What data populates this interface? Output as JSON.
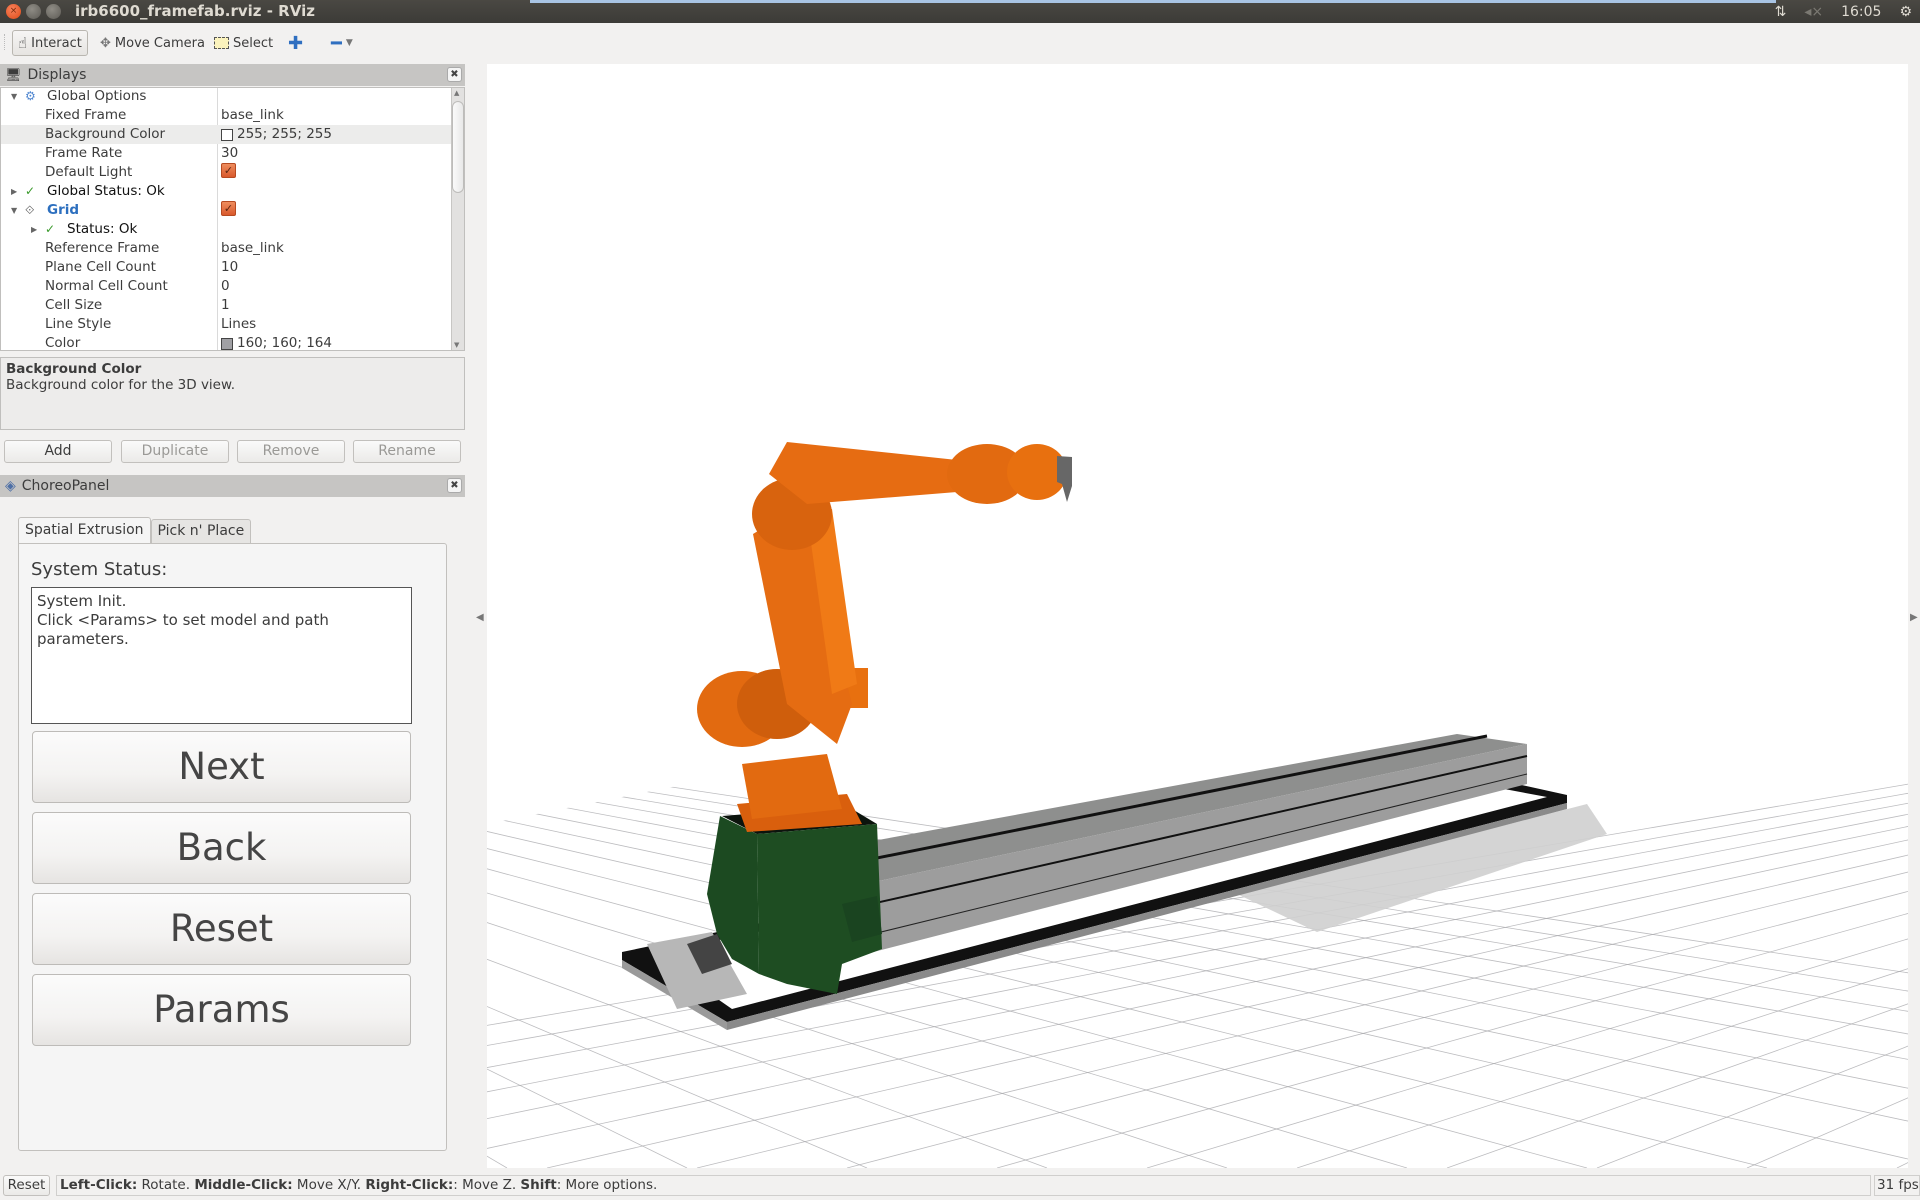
{
  "window": {
    "title": "irb6600_framefab.rviz - RViz",
    "buttons": {
      "close": "×",
      "minimize": "–",
      "maximize": "□"
    }
  },
  "tray": {
    "network_icon": "⇅",
    "volume_icon": "🔇",
    "volume_glyph": "◂×",
    "clock": "16:05",
    "power_icon": "⚙"
  },
  "toolbar": {
    "tools": [
      {
        "label": "Interact",
        "icon": "hand-pointer-icon",
        "glyph": "☝",
        "active": true
      },
      {
        "label": "Move Camera",
        "icon": "move-camera-icon",
        "glyph": "✥",
        "active": false
      },
      {
        "label": "Select",
        "icon": "select-box-icon",
        "glyph": "",
        "active": false
      }
    ],
    "add_tool_glyph": "✚",
    "remove_tool_glyph": "━",
    "dropdown_glyph": "▼"
  },
  "displays_panel": {
    "title": "Displays",
    "icon_glyph": "🖥",
    "close_glyph": "✖",
    "rows": [
      {
        "indent": 0,
        "expander": "▼",
        "icon": "gear-icon",
        "icon_glyph": "⚙",
        "label": "Global Options",
        "value": ""
      },
      {
        "indent": 1,
        "label": "Fixed Frame",
        "value": "base_link"
      },
      {
        "indent": 1,
        "label": "Background Color",
        "value": "255; 255; 255",
        "swatch": "#ffffff",
        "selected": true
      },
      {
        "indent": 1,
        "label": "Frame Rate",
        "value": "30"
      },
      {
        "indent": 1,
        "label": "Default Light",
        "checkbox": true,
        "checked": true
      },
      {
        "indent": 0,
        "expander": "▶",
        "icon": "check-icon",
        "icon_glyph": "✓",
        "label": "Global Status: Ok",
        "value": ""
      },
      {
        "indent": 0,
        "expander": "▼",
        "icon": "grid-icon",
        "icon_glyph": "⟐",
        "label": "Grid",
        "value": "",
        "checkbox": true,
        "checked": true,
        "highlight": true
      },
      {
        "indent": 1,
        "expander": "▶",
        "icon": "check-icon",
        "icon_glyph": "✓",
        "label": "Status: Ok",
        "value": ""
      },
      {
        "indent": 1,
        "label": "Reference Frame",
        "value": "base_link"
      },
      {
        "indent": 1,
        "label": "Plane Cell Count",
        "value": "10"
      },
      {
        "indent": 1,
        "label": "Normal Cell Count",
        "value": "0"
      },
      {
        "indent": 1,
        "label": "Cell Size",
        "value": "1"
      },
      {
        "indent": 1,
        "label": "Line Style",
        "value": "Lines"
      },
      {
        "indent": 1,
        "label": "Color",
        "value": "160; 160; 164",
        "swatch": "#a0a0a4"
      }
    ],
    "description": {
      "title": "Background Color",
      "text": "Background color for the 3D view."
    },
    "buttons": {
      "add": "Add",
      "duplicate": "Duplicate",
      "remove": "Remove",
      "rename": "Rename"
    }
  },
  "choreo_panel": {
    "title": "ChoreoPanel",
    "icon_glyph": "◈",
    "close_glyph": "✖",
    "tabs": [
      {
        "label": "Spatial Extrusion",
        "active": true
      },
      {
        "label": "Pick n' Place",
        "active": false
      }
    ],
    "system_status_label": "System Status:",
    "system_status_text": "System Init.\nClick <Params> to set model and path\nparameters.",
    "buttons": {
      "next": "Next",
      "back": "Back",
      "reset": "Reset",
      "params": "Params"
    }
  },
  "viewport": {
    "background_color": "#ffffff",
    "grid_color": "#a0a0a4",
    "robot_color": "#e8680f",
    "base_color": "#1e4d22",
    "rail_color": "#8f908f",
    "left_collapse_glyph": "◀",
    "right_collapse_glyph": "▶"
  },
  "statusbar": {
    "reset_label": "Reset",
    "hints": [
      {
        "key": "Left-Click:",
        "text": " Rotate. "
      },
      {
        "key": "Middle-Click:",
        "text": " Move X/Y. "
      },
      {
        "key": "Right-Click:",
        "text": ": Move Z. "
      },
      {
        "key": "Shift",
        "text": ": More options."
      }
    ],
    "fps": "31 fps"
  }
}
